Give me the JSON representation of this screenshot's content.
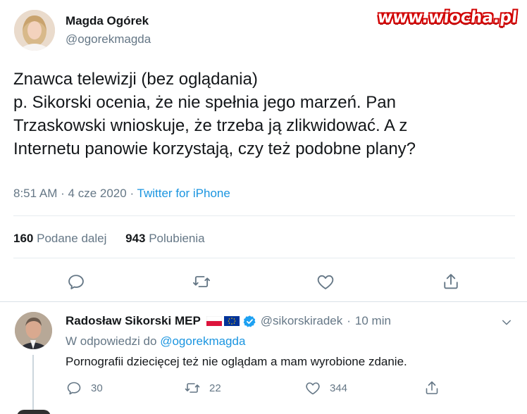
{
  "watermark": "www.wiocha.pl",
  "main_tweet": {
    "author_name": "Magda Ogórek",
    "author_handle": "@ogorekmagda",
    "text_lines": [
      "Znawca telewizji (bez oglądania)",
      "p. Sikorski ocenia, że nie spełnia jego marzeń. Pan",
      "Trzaskowski wnioskuje, że trzeba ją zlikwidować. A z",
      "Internetu panowie korzystają, czy też podobne plany?"
    ],
    "time": "8:51 AM",
    "date": "4 cze 2020",
    "separator": "·",
    "source": "Twitter for iPhone",
    "retweets_count": "160",
    "retweets_label": "Podane dalej",
    "likes_count": "943",
    "likes_label": "Polubienia"
  },
  "reply_tweet": {
    "author_name": "Radosław Sikorski MEP",
    "author_handle": "@sikorskiradek",
    "separator": "·",
    "time": "10 min",
    "reply_prefix": "W odpowiedzi do",
    "reply_mention": "@ogorekmagda",
    "text": "Pornografii dziecięcej też nie oglądam a mam wyrobione zdanie.",
    "reply_count": "30",
    "retweet_count": "22",
    "like_count": "344"
  },
  "icons": {
    "reply": "reply-icon",
    "retweet": "retweet-icon",
    "like": "heart-icon",
    "share": "share-icon",
    "verified": "verified-badge-icon",
    "chevron": "chevron-down-icon",
    "flag_pl": "poland-flag-icon",
    "flag_eu": "eu-flag-icon"
  },
  "colors": {
    "text": "#14171a",
    "secondary": "#657786",
    "link": "#1b95e0",
    "verified": "#1da1f2",
    "watermark_outline": "#d10000"
  }
}
